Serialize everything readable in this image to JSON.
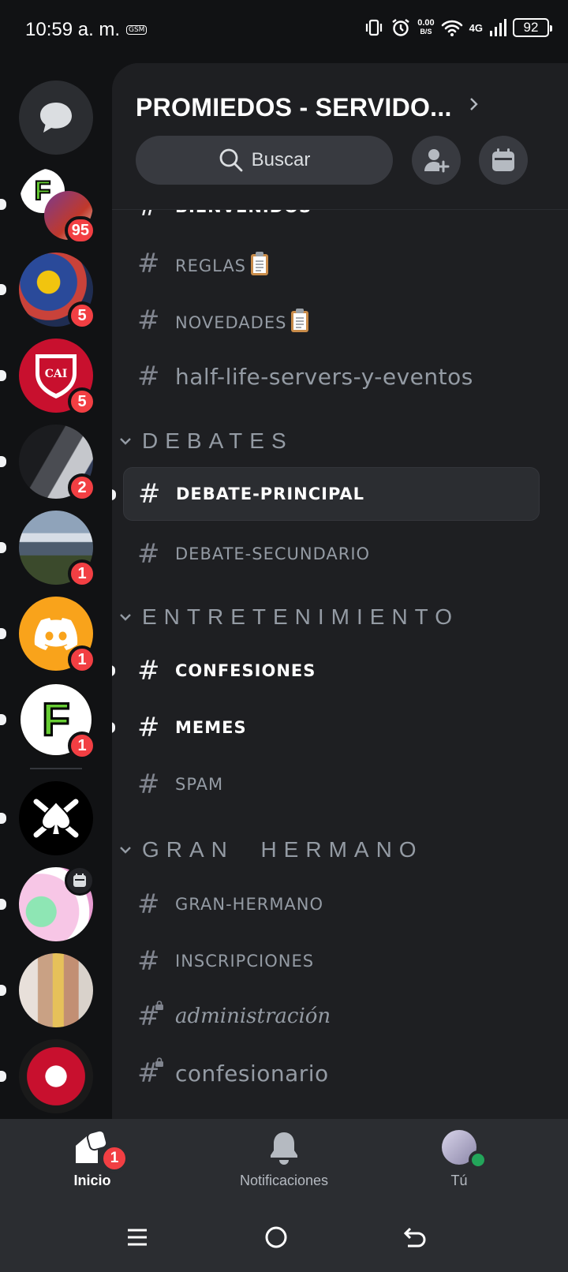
{
  "status_bar": {
    "time": "10:59 a. m.",
    "gsm": "GSM",
    "net_speed": "0.00",
    "net_unit": "B/S",
    "network": "4G",
    "battery": "92"
  },
  "servers": [
    {
      "name": "F-server",
      "badge": "95",
      "colors": [
        "#2f8f2f",
        "#c0392b"
      ]
    },
    {
      "name": "boca-photo",
      "badge": "5",
      "colors": [
        "#2a4a9a",
        "#f1c40f"
      ]
    },
    {
      "name": "independiente",
      "badge": "5",
      "colors": [
        "#c8102e",
        "#ffffff"
      ]
    },
    {
      "name": "photo-people",
      "badge": "2",
      "colors": [
        "#3d3f45",
        "#c5c7cc"
      ]
    },
    {
      "name": "mountains",
      "badge": "1",
      "colors": [
        "#6b7f96",
        "#3b4a2c"
      ]
    },
    {
      "name": "discord-orange",
      "badge": "1",
      "colors": [
        "#f9a31b",
        "#ffffff"
      ]
    },
    {
      "name": "F-ball",
      "badge": "1",
      "colors": [
        "#ffffff",
        "#66cc33"
      ]
    },
    {
      "name": "spade-skull",
      "badge": "",
      "colors": [
        "#000000",
        "#ffffff"
      ]
    },
    {
      "name": "pink-art",
      "badge": "",
      "colors": [
        "#f7c6e6",
        "#8ee6b4"
      ]
    },
    {
      "name": "photo-girls",
      "badge": "",
      "colors": [
        "#c9b6a4",
        "#e8e0da"
      ]
    },
    {
      "name": "independiente-2",
      "badge": "",
      "colors": [
        "#c8102e",
        "#1a1a1a"
      ]
    }
  ],
  "header": {
    "title": "PROMIEDOS - SERVIDO...",
    "search_label": "Buscar"
  },
  "channels": {
    "partial": {
      "name": "BIENVENIDOS"
    },
    "reglas": {
      "name": "REGLAS"
    },
    "novedades": {
      "name": "NOVEDADES"
    },
    "halflife": {
      "name": "half-life-servers-y-eventos"
    },
    "cat_debates": "DEBATES",
    "debate_principal": {
      "name": "DEBATE-PRINCIPAL"
    },
    "debate_secundario": {
      "name": "DEBATE-SECUNDARIO"
    },
    "cat_entretenimiento": "ENTRETENIMIENTO",
    "confesiones": {
      "name": "CONFESIONES"
    },
    "memes": {
      "name": "MEMES"
    },
    "spam": {
      "name": "SPAM"
    },
    "cat_gran_hermano": "GRAN  HERMANO",
    "gran_hermano": {
      "name": "GRAN-HERMANO"
    },
    "inscripciones": {
      "name": "INSCRIPCIONES"
    },
    "administracion": {
      "name": "administración"
    },
    "confesionario": {
      "name": "confesionario"
    }
  },
  "bottom_nav": {
    "home": "Inicio",
    "home_badge": "1",
    "notifications": "Notificaciones",
    "you": "Tú"
  },
  "colors": {
    "accent_red": "#f23f43",
    "online_green": "#23a55a",
    "panel_bg": "#1e1f22",
    "rail_bg": "#111214"
  }
}
